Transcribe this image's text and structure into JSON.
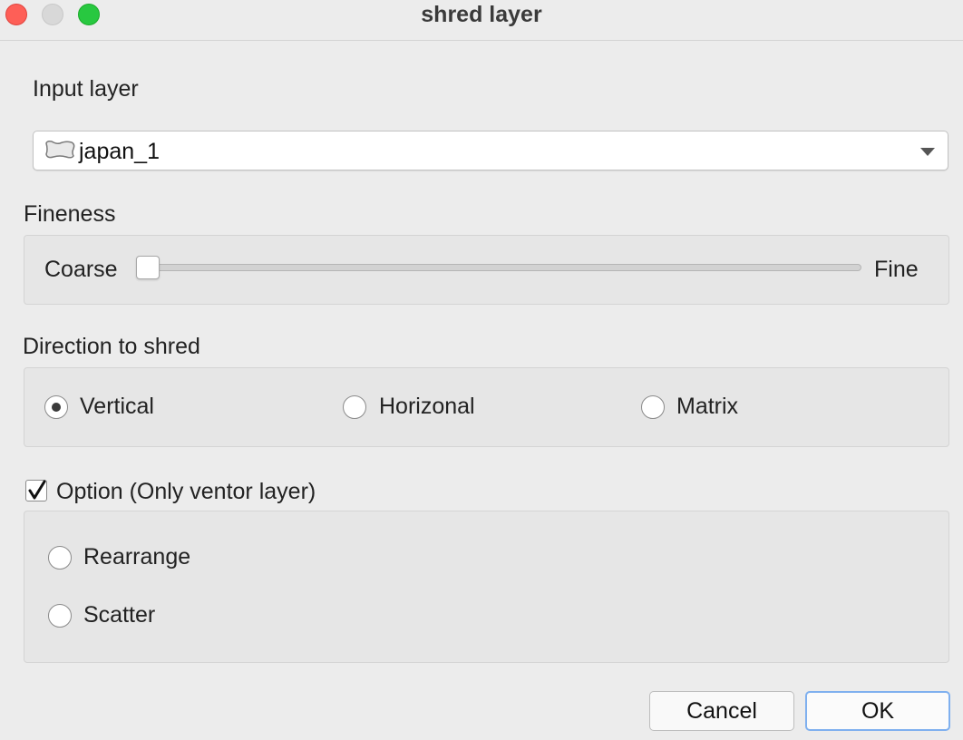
{
  "window": {
    "title": "shred layer"
  },
  "input_layer": {
    "label": "Input layer",
    "selected_value": "japan_1",
    "icon": "polygon-layer-icon"
  },
  "fineness": {
    "label": "Fineness",
    "min_label": "Coarse",
    "max_label": "Fine",
    "value_fraction": 0.0
  },
  "direction": {
    "label": "Direction to shred",
    "options": [
      {
        "label": "Vertical",
        "selected": true
      },
      {
        "label": "Horizonal",
        "selected": false
      },
      {
        "label": "Matrix",
        "selected": false
      }
    ]
  },
  "option": {
    "label": "Option (Only ventor layer)",
    "checked": true,
    "choices": [
      {
        "label": "Rearrange",
        "selected": false
      },
      {
        "label": "Scatter",
        "selected": false
      }
    ]
  },
  "buttons": {
    "cancel_label": "Cancel",
    "ok_label": "OK"
  },
  "colors": {
    "close": "#fe5f57",
    "minimize": "#d8d8d8",
    "zoom": "#28c840",
    "default_button_focus": "#7fb0ef"
  }
}
